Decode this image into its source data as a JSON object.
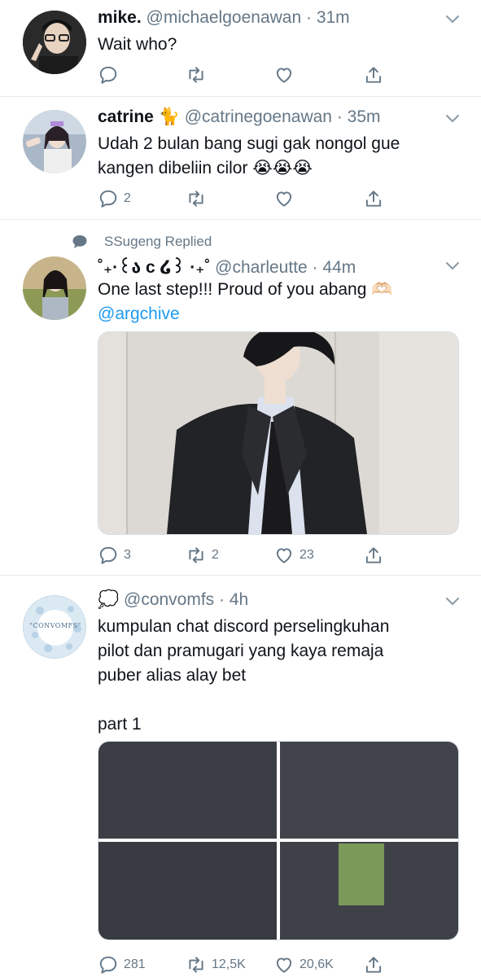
{
  "tweets": [
    {
      "name": "mike.",
      "handle": "@michaelgoenawan",
      "time": "31m",
      "text": [
        "Wait who?"
      ],
      "replies": "",
      "retweets": "",
      "likes": ""
    },
    {
      "name": "catrine 🐈",
      "handle": "@catrinegoenawan",
      "time": "35m",
      "text": [
        "Udah 2 bulan bang sugi gak nongol gue",
        "kangen dibeliin cilor 😭😭😭"
      ],
      "replies": "2",
      "retweets": "",
      "likes": ""
    },
    {
      "context": "SSugeng Replied",
      "name": "˚₊·꒰ა c ໒꒱ ·₊˚",
      "handle": "@charleutte",
      "time": "44m",
      "text": [
        "One last step!!! Proud of you abang 🫶🏻"
      ],
      "mention": "@argchive",
      "replies": "3",
      "retweets": "2",
      "likes": "23"
    },
    {
      "name": "💭",
      "handle": "@convomfs",
      "time": "4h",
      "text": [
        "kumpulan chat discord perselingkuhan",
        "pilot dan pramugari yang kaya remaja",
        "puber alias alay bet",
        "",
        "part 1"
      ],
      "avatar_text": "\"CONVOMFS\"",
      "replies": "281",
      "retweets": "12,5K",
      "likes": "20,6K"
    }
  ],
  "colors": {
    "accent": "#1d9bf0",
    "muted": "#657786",
    "separator": "#e6ecf0"
  },
  "icons": [
    "reply-icon",
    "retweet-icon",
    "like-icon",
    "share-icon",
    "chevron-down-icon",
    "speech-bubble-icon"
  ]
}
